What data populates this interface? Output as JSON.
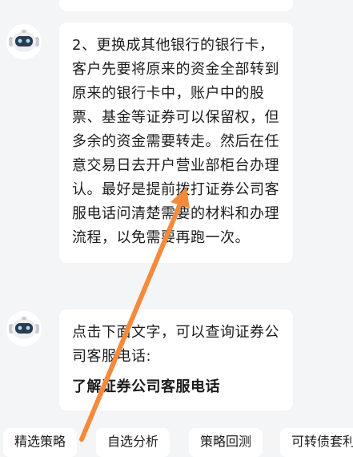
{
  "messages": [
    {
      "text": "2、更换成其他银行的银行卡，客户先要将原来的资金全部转到原来的银行卡中，账户中的股票、基金等证券可以保留权，但多余的资金需要转走。然后在任意交易日去开户营业部柜台办理认。最好是提前拨打证券公司客服电话问清楚需要的材料和办理流程，以免需要再跑一次。"
    },
    {
      "text": "点击下面文字，可以查询证券公司客服电话:",
      "link": "了解证券公司客服电话"
    }
  ],
  "quick_actions": [
    "精选策略",
    "自选分析",
    "策略回测",
    "可转债套利"
  ],
  "colors": {
    "arrow": "#f58a3c",
    "background": "#f4f5f7",
    "bubble": "#ffffff",
    "robot": "#2d3a4e"
  },
  "icons": {
    "avatar": "robot-icon"
  }
}
